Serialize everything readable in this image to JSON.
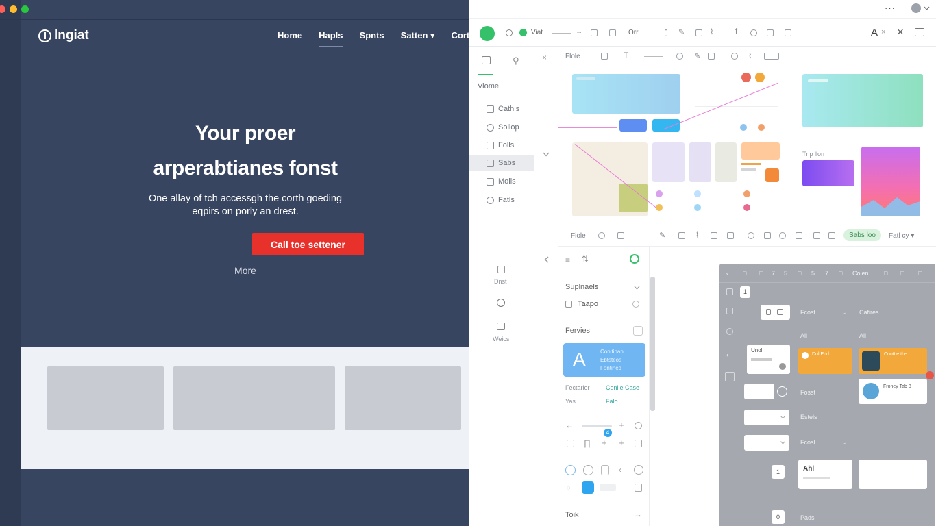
{
  "window": {
    "traffic_colors": [
      "#ff5f57",
      "#febc2e",
      "#28c840"
    ]
  },
  "site": {
    "logo_text": "lngiat",
    "nav": [
      "Home",
      "Hapls",
      "Spnts",
      "Satten ▾",
      "Corte"
    ],
    "hero_title_line1": "Your proer",
    "hero_title_line2": "arperabtianes fonst",
    "hero_sub_line1": "One allay of tch accessgh the corth goeding",
    "hero_sub_line2": "eqpirs on porly an drest.",
    "cta_label": "Call toe settener",
    "more_label": "More",
    "accent": "#e8312a"
  },
  "editor": {
    "toolbar_label": "Viat",
    "toolbar_mid": "Orr",
    "toolbar_right_label": "A",
    "toolbar_close": "×",
    "top_menu": "···",
    "sidebar_heading": "Viome",
    "sidebar_items": [
      "Cathls",
      "Sollop",
      "Folls",
      "Sabs",
      "Molls",
      "Fatls"
    ],
    "sidebar_bottom": [
      "Dnst",
      "Weics"
    ],
    "canvas_toolbar_label": "Flole",
    "bottom_toolbar_label": "Fiole",
    "bottom_toolbar_chip": "Sabs loo",
    "bottom_toolbar_right": "Fatl cy ▾",
    "frame_label": "Tnp llon",
    "panel": {
      "section1": "Suplnaels",
      "item1": "Taapo",
      "section2": "Fervies",
      "card_lines": [
        "Conltinan",
        "Ebtsteos",
        "Fontined"
      ],
      "left_label": "Fectarler",
      "left_sub": "Yas",
      "right_label": "Conlle Case",
      "right_sub": "Falo",
      "badge": "4",
      "footer": "Toik"
    },
    "flow": {
      "header": "Colen",
      "step1": "1",
      "labels": [
        "Fcost",
        "Cafires",
        "All",
        "All",
        "Fosst",
        "Estels",
        "Fcosl",
        "Pads"
      ],
      "node_text": "Unol",
      "orange1": "Dol Edd",
      "orange2": "Conttle the",
      "profile": "Froney Tab 8",
      "ahl": "Ahl",
      "badge": "0",
      "count": "1",
      "bottom_step": "0"
    },
    "accent_blue": "#6fb6f3",
    "accent_green": "#35c16a"
  }
}
